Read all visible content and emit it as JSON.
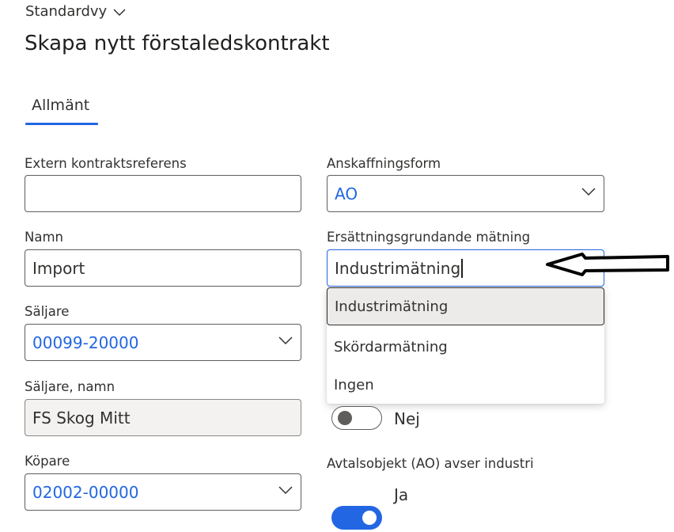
{
  "header": {
    "view_label": "Standardvy",
    "title": "Skapa nytt förstaledskontrakt"
  },
  "tabs": [
    {
      "label": "Allmänt",
      "active": true
    }
  ],
  "fields": {
    "extern_ref": {
      "label": "Extern kontraktsreferens",
      "value": ""
    },
    "namn": {
      "label": "Namn",
      "value": "Import"
    },
    "saljare": {
      "label": "Säljare",
      "value": "00099-20000"
    },
    "saljare_namn": {
      "label": "Säljare, namn",
      "value": "FS Skog Mitt"
    },
    "kopare": {
      "label": "Köpare",
      "value": "02002-00000"
    },
    "anskaffningsform": {
      "label": "Anskaffningsform",
      "value": "AO"
    },
    "matning": {
      "label": "Ersättningsgrundande mätning",
      "value": "Industrimätning",
      "options": [
        "Industrimätning",
        "Skördarmätning",
        "Ingen"
      ],
      "selected_index": 0
    },
    "toggle_hidden": {
      "state_label": "Nej",
      "on": false
    },
    "avtalsobjekt": {
      "label": "Avtalsobjekt (AO) avser industri",
      "state_label": "Ja",
      "on": true
    }
  },
  "colors": {
    "accent": "#2266e3",
    "text": "#323130",
    "readonly_bg": "#f3f2f1"
  }
}
